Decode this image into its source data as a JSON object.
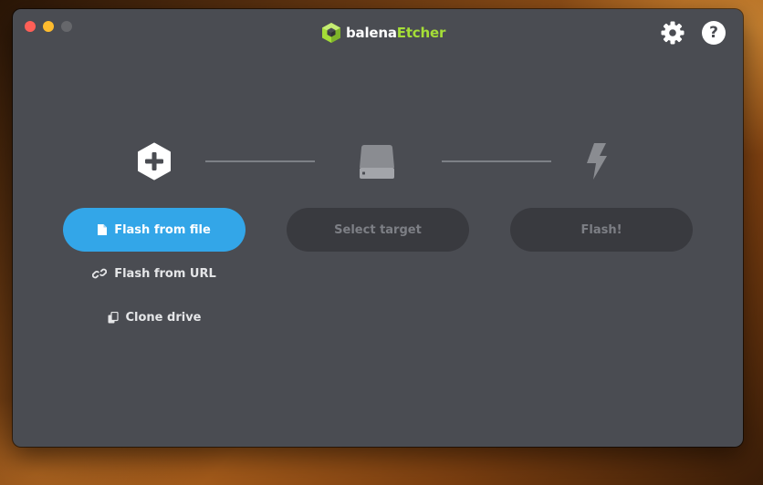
{
  "window": {
    "controls": {
      "close_color": "#ff5f57",
      "minimize_color": "#febc2e",
      "zoom_color": "#66676b"
    }
  },
  "header": {
    "logo_part1": "balena",
    "logo_part2": "Etcher",
    "logo_icon": "cube-icon",
    "settings_icon": "gear-icon",
    "help_icon": "question-icon",
    "help_glyph": "?"
  },
  "steps": {
    "source": {
      "icon": "plus-hexagon-icon",
      "primary_button": "Flash from file",
      "secondary_options": [
        {
          "label": "Flash from URL",
          "icon": "link-icon"
        },
        {
          "label": "Clone drive",
          "icon": "copy-icon"
        }
      ]
    },
    "target": {
      "icon": "drive-icon",
      "button": "Select target"
    },
    "flash": {
      "icon": "lightning-icon",
      "button": "Flash!"
    }
  },
  "colors": {
    "accent": "#33a6e8",
    "brand_green": "#a5de37",
    "window_bg": "#4a4c52",
    "disabled_button": "#393a3f"
  }
}
